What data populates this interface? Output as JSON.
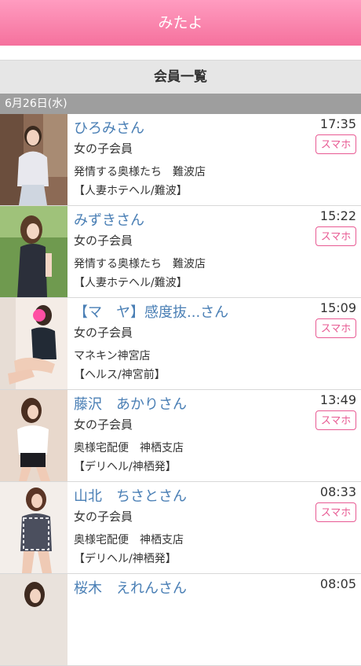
{
  "header": {
    "title": "みたよ"
  },
  "section": {
    "title": "会員一覧"
  },
  "date_label": "6月26日(水)",
  "members": [
    {
      "name": "ひろみさん",
      "role": "女の子会員",
      "shop": "発情する奥様たち　難波店",
      "genre": "【人妻ホテヘル/難波】",
      "time": "17:35",
      "badge": "スマホ"
    },
    {
      "name": "みずきさん",
      "role": "女の子会員",
      "shop": "発情する奥様たち　難波店",
      "genre": "【人妻ホテヘル/難波】",
      "time": "15:22",
      "badge": "スマホ"
    },
    {
      "name": "【マ　ヤ】感度抜...さん",
      "role": "女の子会員",
      "shop": "マネキン神宮店",
      "genre": "【ヘルス/神宮前】",
      "time": "15:09",
      "badge": "スマホ"
    },
    {
      "name": "藤沢　あかりさん",
      "role": "女の子会員",
      "shop": "奥様宅配便　神栖支店",
      "genre": "【デリヘル/神栖発】",
      "time": "13:49",
      "badge": "スマホ"
    },
    {
      "name": "山北　ちさとさん",
      "role": "女の子会員",
      "shop": "奥様宅配便　神栖支店",
      "genre": "【デリヘル/神栖発】",
      "time": "08:33",
      "badge": "スマホ"
    },
    {
      "name": "桜木　えれんさん",
      "time": "08:05"
    }
  ]
}
